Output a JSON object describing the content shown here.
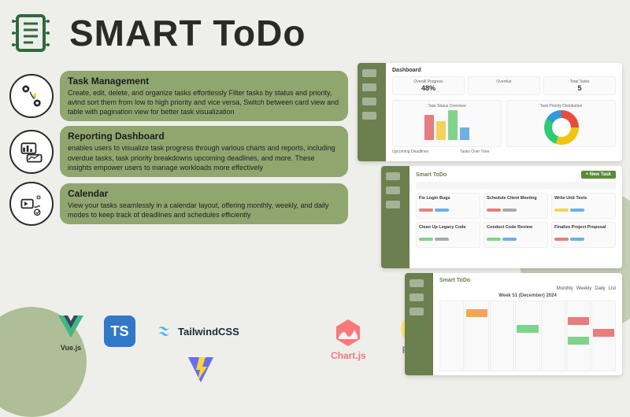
{
  "hero": {
    "title": "SMART ToDo"
  },
  "features": [
    {
      "title": "Task Management",
      "desc": "Create, edit, delete, and organize tasks effortlessly\nFilter tasks by status and priority, avtnd sort them from low to high priority and vice versa, Switch between card view and table with pagination view for better task visualization"
    },
    {
      "title": "Reporting Dashboard",
      "desc": "enables users to visualize task progress through various charts and reports, including overdue tasks, task priority breakdowns upcoming deadlines, and more. These insights empower users to manage workloads more effectively"
    },
    {
      "title": "Calendar",
      "desc": "View your tasks seamlessly in a calendar layout, offering monthly, weekly, and daily modes to keep track of deadlines and schedules efficiently"
    }
  ],
  "tech": {
    "vue": "Vue.js",
    "ts": "TS",
    "tailwind": "TailwindCSS",
    "chartjs": "Chart.js",
    "pinia": "Pinia",
    "vite": ""
  },
  "mock": {
    "dashboard": {
      "title": "Dashboard",
      "stats": [
        {
          "label": "Overall Progress",
          "value": "48%"
        },
        {
          "label": "Overdue",
          "value": ""
        },
        {
          "label": "Total Tasks",
          "value": "5"
        }
      ],
      "barTitle": "Task Status Overview",
      "donutTitle": "Task Priority Distribution",
      "footer1": "Upcoming Deadlines",
      "footer2": "Tasks Over Time"
    },
    "tasks": {
      "header": "Smart ToDo",
      "newBtn": "+ New Task",
      "cards": [
        "Fix Login Bugs",
        "Schedule Client Meeting",
        "Write Unit Tests",
        "Clean Up Legacy Code",
        "Conduct Code Review",
        "Finalize Project Proposal"
      ]
    },
    "calendar": {
      "header": "Smart ToDo",
      "week": "Week 51 (December) 2024",
      "tabs": [
        "Monthly",
        "Weekly",
        "Daily",
        "List"
      ]
    }
  }
}
